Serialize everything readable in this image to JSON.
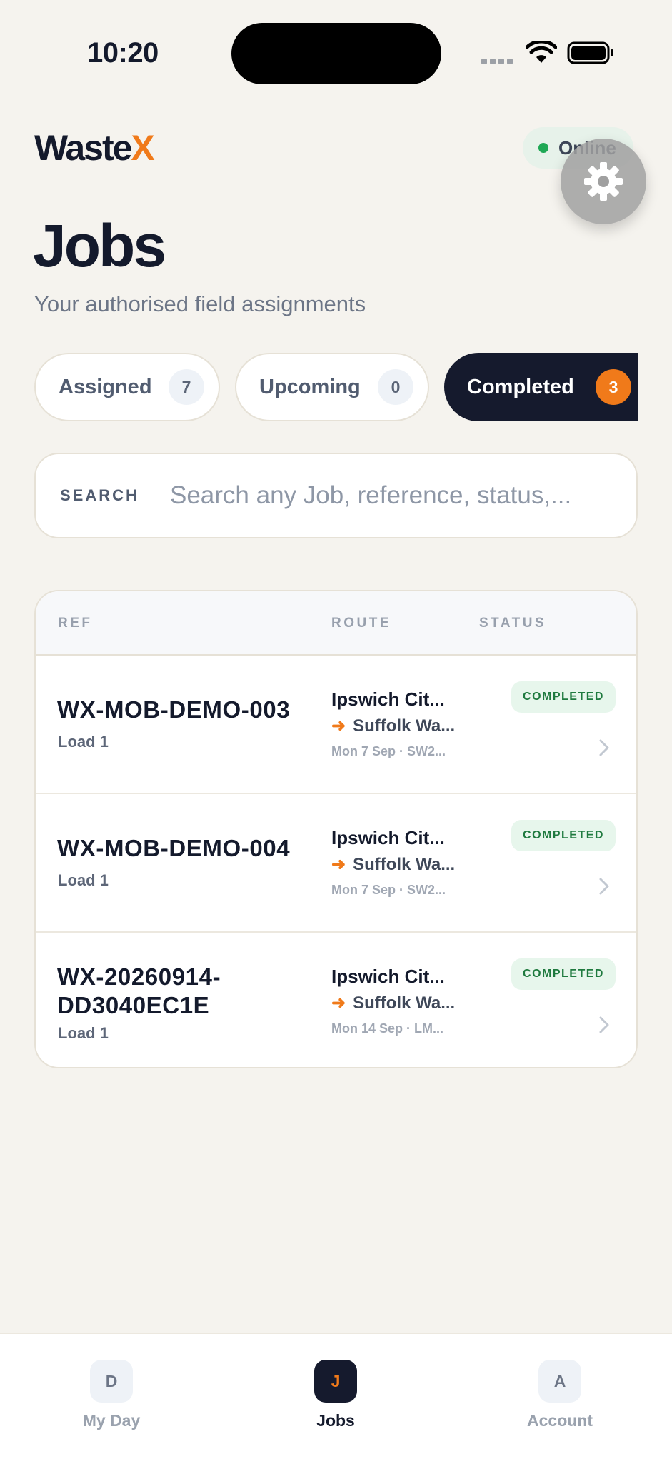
{
  "status_bar": {
    "time": "10:20"
  },
  "header": {
    "logo_main": "Waste",
    "logo_accent": "X",
    "online_label": "Online",
    "title": "Jobs",
    "subtitle": "Your authorised field assignments"
  },
  "tabs": [
    {
      "label": "Assigned",
      "count": "7",
      "active": false
    },
    {
      "label": "Upcoming",
      "count": "0",
      "active": false
    },
    {
      "label": "Completed",
      "count": "3",
      "active": true
    }
  ],
  "search": {
    "label": "SEARCH",
    "placeholder": "Search any Job, reference, status,..."
  },
  "table": {
    "headers": {
      "ref": "REF",
      "route": "ROUTE",
      "status": "STATUS"
    },
    "rows": [
      {
        "ref": "WX-MOB-DEMO-003",
        "load": "Load 1",
        "from": "Ipswich Cit...",
        "to": "Suffolk Wa...",
        "meta": "Mon 7 Sep · SW2...",
        "status": "COMPLETED"
      },
      {
        "ref": "WX-MOB-DEMO-004",
        "load": "Load 1",
        "from": "Ipswich Cit...",
        "to": "Suffolk Wa...",
        "meta": "Mon 7 Sep · SW2...",
        "status": "COMPLETED"
      },
      {
        "ref": "WX-20260914-DD3040EC1E",
        "load": "Load 1",
        "from": "Ipswich Cit...",
        "to": "Suffolk Wa...",
        "meta": "Mon 14 Sep · LM...",
        "status": "COMPLETED"
      }
    ]
  },
  "nav": [
    {
      "letter": "D",
      "label": "My Day",
      "active": false
    },
    {
      "letter": "J",
      "label": "Jobs",
      "active": true
    },
    {
      "letter": "A",
      "label": "Account",
      "active": false
    }
  ],
  "icons": {
    "settings": "gear-icon",
    "route_arrow": "arrow-right-icon",
    "row_chevron": "chevron-right-icon",
    "wifi": "wifi-icon",
    "battery": "battery-icon",
    "signal": "signal-icon"
  },
  "colors": {
    "accent": "#f07a1a",
    "dark": "#151a2d",
    "online": "#1fa855",
    "completed_badge_bg": "#e7f6ec",
    "completed_badge_text": "#1f7a3f"
  }
}
